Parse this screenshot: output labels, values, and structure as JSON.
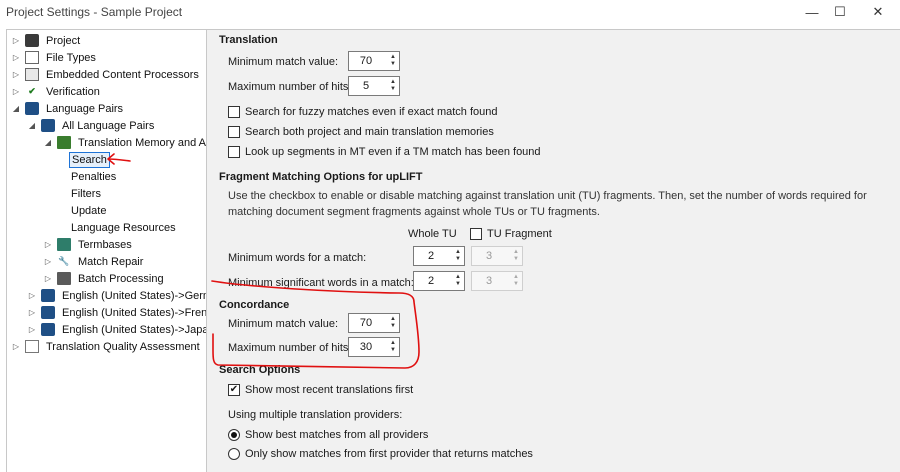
{
  "window": {
    "title": "Project Settings - Sample Project",
    "minimize_glyph": "—",
    "maximize_glyph": "☐",
    "close_glyph": "✕"
  },
  "tree": {
    "project": "Project",
    "file_types": "File Types",
    "embedded": "Embedded Content Processors",
    "verification": "Verification",
    "language_pairs": "Language Pairs",
    "all_language_pairs": "All Language Pairs",
    "tm_and_auto": "Translation Memory and Auto",
    "search": "Search",
    "penalties": "Penalties",
    "filters": "Filters",
    "update": "Update",
    "language_resources": "Language Resources",
    "termbases": "Termbases",
    "match_repair": "Match Repair",
    "batch_processing": "Batch Processing",
    "en_de": "English (United States)->German (",
    "en_fr": "English (United States)->French (F",
    "en_ja": "English (United States)->Japanese",
    "tqa": "Translation Quality Assessment"
  },
  "translation": {
    "heading": "Translation",
    "min_match_label": "Minimum match value:",
    "min_match_value": "70",
    "max_hits_label": "Maximum number of hits:",
    "max_hits_value": "5",
    "opt_fuzzy": "Search for fuzzy matches even if exact match found",
    "opt_both": "Search both project and main translation memories",
    "opt_mt": "Look up segments in MT even if a TM match has been found"
  },
  "fragment": {
    "heading": "Fragment Matching Options for upLIFT",
    "description": "Use the checkbox to enable or disable matching against translation unit (TU)  fragments. Then, set the number of words required for matching document segment fragments against whole TUs or TU fragments.",
    "col_whole_tu": "Whole TU",
    "col_tu_fragment": "TU Fragment",
    "min_words_label": "Minimum words for a match:",
    "min_words_whole": "2",
    "min_words_fragment": "3",
    "min_sig_label": "Minimum significant words in a match:",
    "min_sig_whole": "2",
    "min_sig_fragment": "3"
  },
  "concordance": {
    "heading": "Concordance",
    "min_match_label": "Minimum match value:",
    "min_match_value": "70",
    "max_hits_label": "Maximum number of hits:",
    "max_hits_value": "30"
  },
  "search_options": {
    "heading": "Search Options",
    "show_recent": "Show most recent translations first",
    "show_recent_checked": true,
    "multi_providers_label": "Using multiple translation providers:",
    "radio_best": "Show best matches from all providers",
    "radio_first": "Only show matches from first provider that returns matches"
  },
  "icons": {
    "expand_closed": "▷",
    "expand_open": "◢",
    "spin_up": "▲",
    "spin_down": "▼",
    "check": "✔"
  },
  "colors": {
    "annotation_red": "#e01010",
    "selection_border": "#1e73d6"
  }
}
